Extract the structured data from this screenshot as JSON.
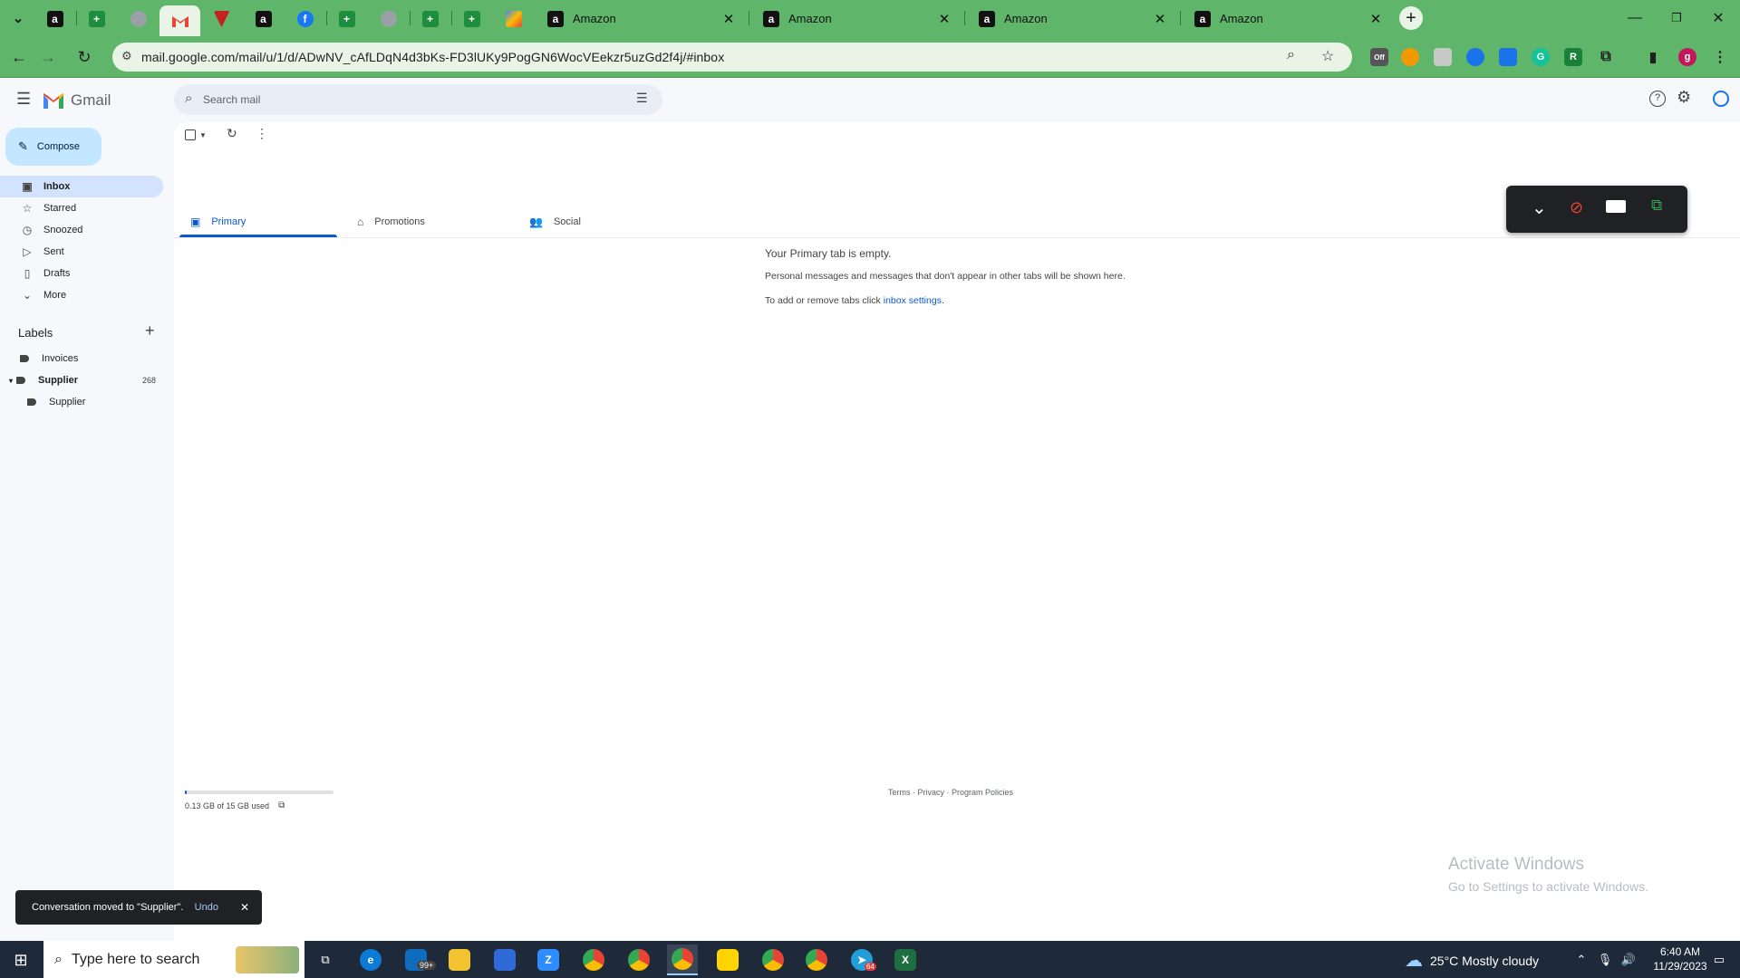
{
  "browser": {
    "tabs": [
      {
        "title": "Amazon",
        "close": "✕"
      },
      {
        "title": "Amazon",
        "close": "✕"
      },
      {
        "title": "Amazon",
        "close": "✕"
      },
      {
        "title": "Amazon",
        "close": "✕"
      }
    ],
    "url": "mail.google.com/mail/u/1/d/ADwNV_cAfLDqN4d3bKs-FD3lUKy9PogGN6WocVEekzr5uzGd2f4j/#inbox",
    "profile_initial": "g",
    "colors": {
      "frame": "#5fb56a",
      "omnibox": "#e9f3e6"
    }
  },
  "gmail": {
    "logo_text": "Gmail",
    "search_placeholder": "Search mail",
    "compose_label": "Compose",
    "nav": [
      {
        "label": "Inbox",
        "icon": "inbox-icon"
      },
      {
        "label": "Starred",
        "icon": "star-icon"
      },
      {
        "label": "Snoozed",
        "icon": "clock-icon"
      },
      {
        "label": "Sent",
        "icon": "send-icon"
      },
      {
        "label": "Drafts",
        "icon": "draft-icon"
      },
      {
        "label": "More",
        "icon": "chevron-down-icon"
      }
    ],
    "labels_heading": "Labels",
    "labels": [
      {
        "name": "Invoices",
        "count": ""
      },
      {
        "name": "Supplier",
        "count": "268"
      },
      {
        "name": "Supplier",
        "count": ""
      }
    ],
    "tabs": [
      {
        "label": "Primary",
        "icon": "inbox-icon"
      },
      {
        "label": "Promotions",
        "icon": "tag-icon"
      },
      {
        "label": "Social",
        "icon": "people-icon"
      }
    ],
    "empty": {
      "title": "Your Primary tab is empty.",
      "line1": "Personal messages and messages that don't appear in other tabs will be shown here.",
      "line2_prefix": "To add or remove tabs click ",
      "line2_link": "inbox settings",
      "line2_suffix": "."
    },
    "storage": {
      "text": "0.13 GB of 15 GB used",
      "used_fraction": 0.009
    },
    "footer": {
      "terms": "Terms",
      "dot": " · ",
      "privacy": "Privacy",
      "policies": "Program Policies"
    },
    "toast": {
      "message": "Conversation moved to \"Supplier\".",
      "undo": "Undo",
      "close": "✕"
    },
    "watermark": {
      "title": "Activate Windows",
      "subtitle": "Go to Settings to activate Windows."
    },
    "colors": {
      "accent": "#0b57d0",
      "selected_nav": "#d3e3fd",
      "compose": "#c2e7ff"
    }
  },
  "taskbar": {
    "search_placeholder": "Type here to search",
    "weather": "25°C  Mostly cloudy",
    "time": "6:40 AM",
    "date": "11/29/2023",
    "mail_badge": "99+",
    "telegram_badge": "64"
  }
}
